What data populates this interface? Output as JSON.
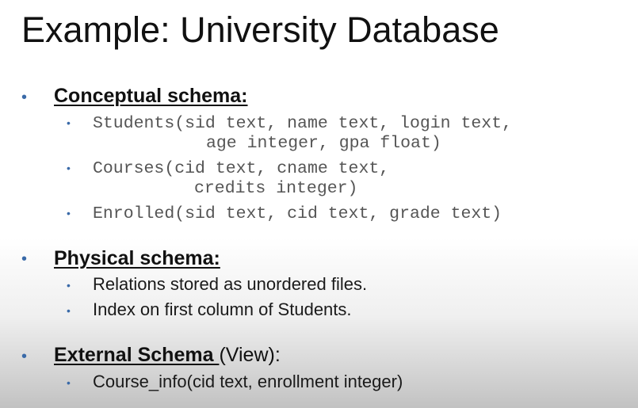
{
  "title": "Example: University Database",
  "sections": {
    "conceptual": {
      "heading": "Conceptual schema:",
      "items": [
        {
          "line1": "Students(sid text, name text, login text,",
          "line2": "age integer, gpa float)"
        },
        {
          "line1": "Courses(cid text, cname text,",
          "line2": "credits integer)"
        },
        {
          "line1": "Enrolled(sid text, cid text, grade text)"
        }
      ]
    },
    "physical": {
      "heading": "Physical schema:",
      "items": [
        "Relations stored as unordered files.",
        "Index on first column of Students."
      ]
    },
    "external": {
      "heading": "External Schema ",
      "heading_suffix": "(View):",
      "items": [
        "Course_info(cid text, enrollment integer)"
      ]
    }
  },
  "bullet_color": "#3a6aa8"
}
